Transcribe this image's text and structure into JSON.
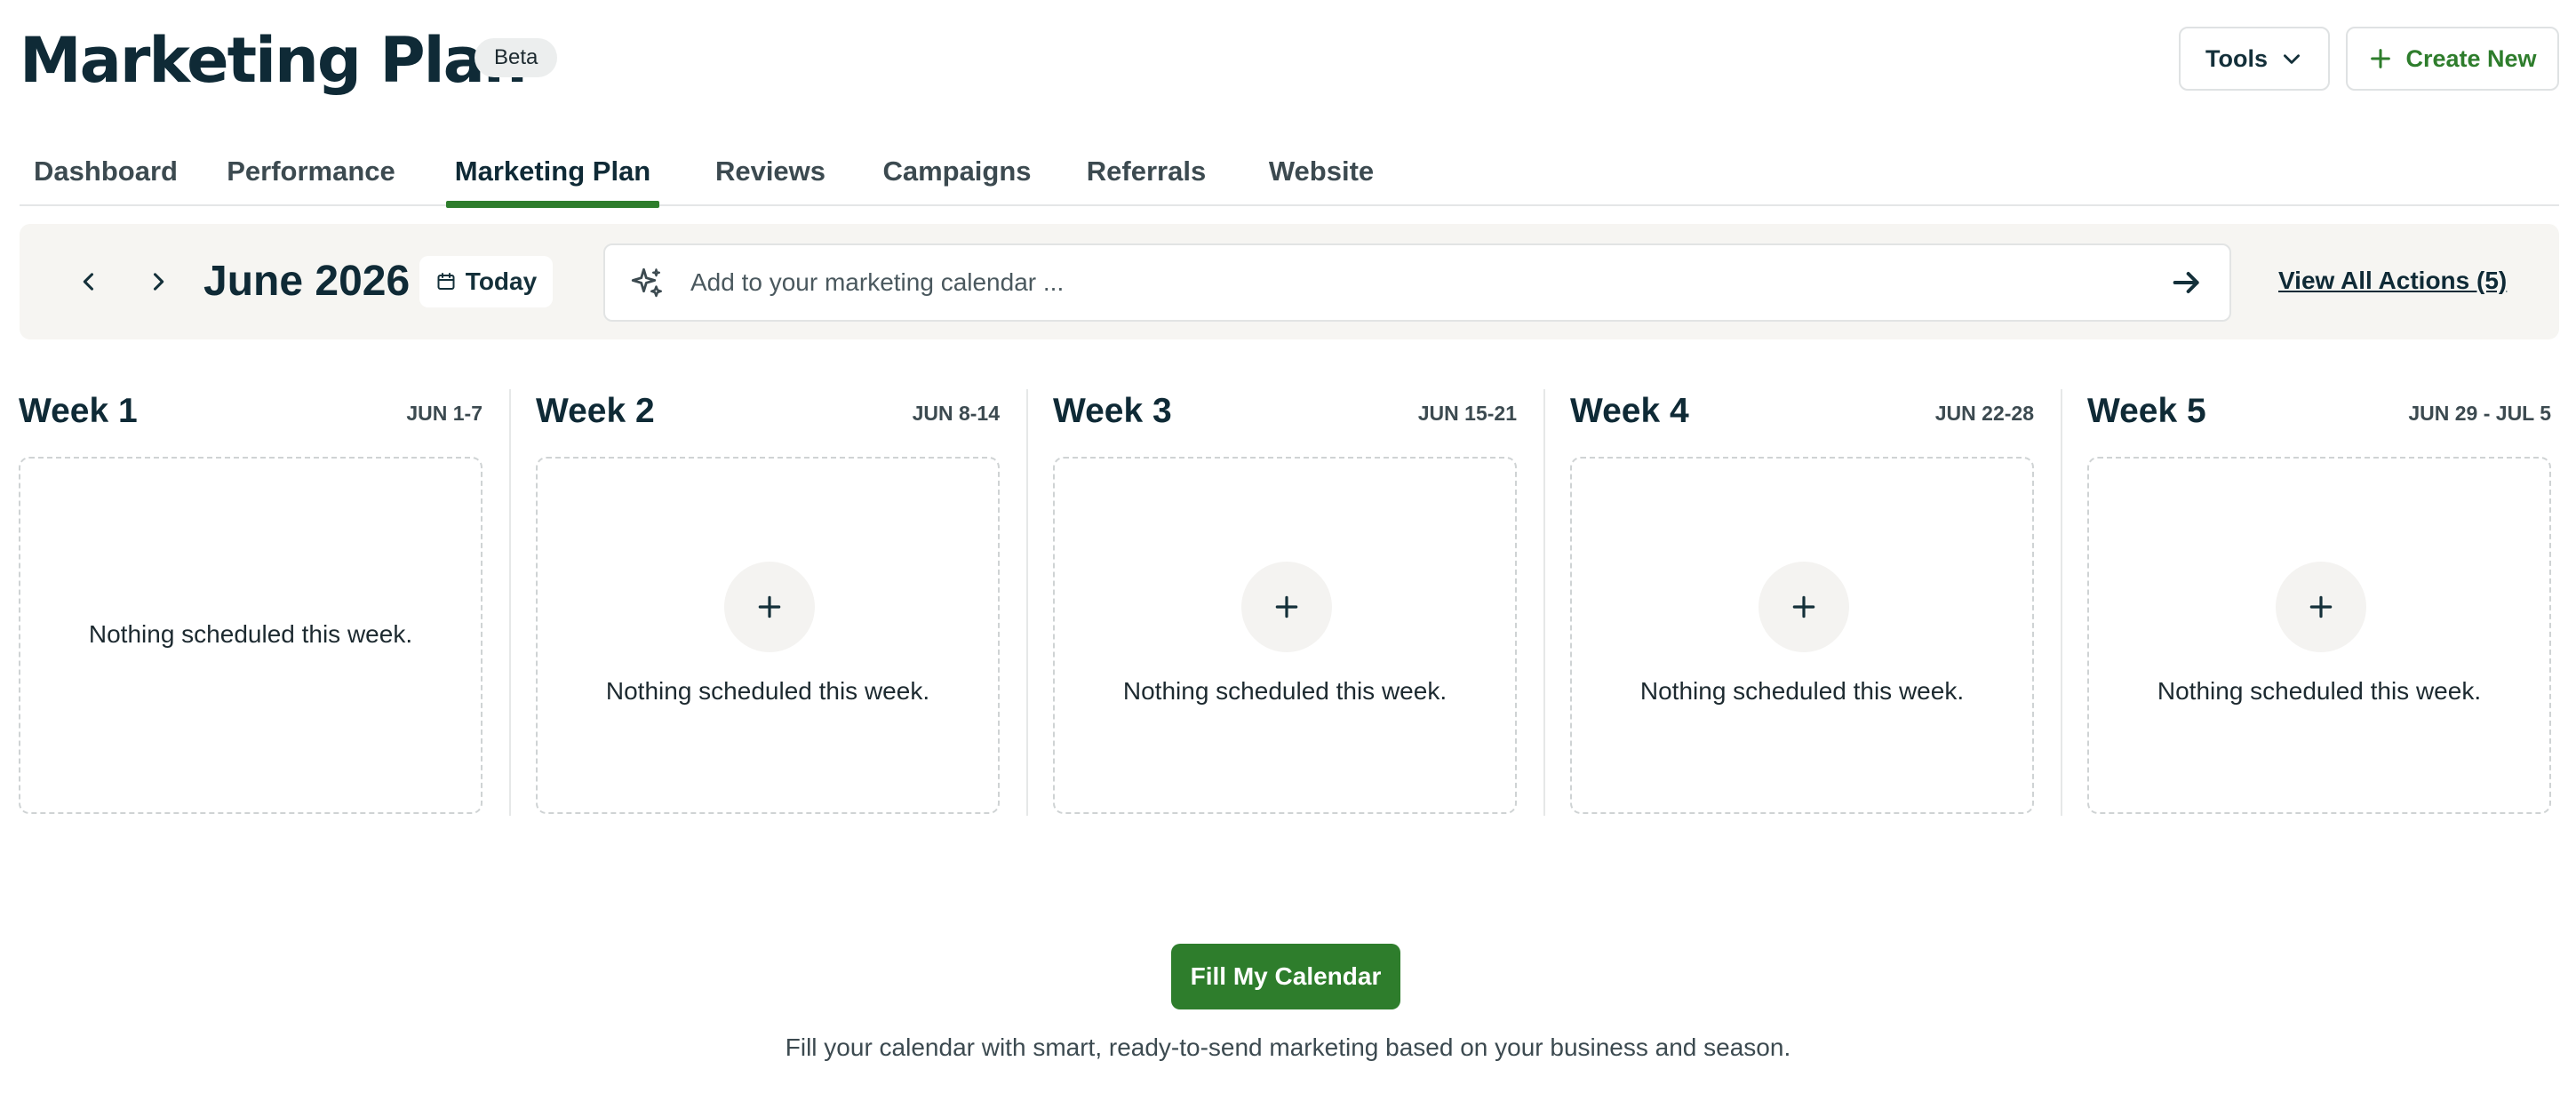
{
  "header": {
    "title": "Marketing Plan",
    "badge": "Beta",
    "tools_label": "Tools",
    "create_label": "Create New"
  },
  "tabs": [
    {
      "label": "Dashboard"
    },
    {
      "label": "Performance"
    },
    {
      "label": "Marketing Plan",
      "active": true
    },
    {
      "label": "Reviews"
    },
    {
      "label": "Campaigns"
    },
    {
      "label": "Referrals"
    },
    {
      "label": "Website"
    }
  ],
  "toolbar": {
    "month": "June 2026",
    "today_label": "Today",
    "input_placeholder": "Add to your marketing calendar ...",
    "view_all_label": "View All Actions (5)"
  },
  "weeks": [
    {
      "title": "Week 1",
      "range": "JUN 1-7",
      "empty_text": "Nothing scheduled this week."
    },
    {
      "title": "Week 2",
      "range": "JUN 8-14",
      "empty_text": "Nothing scheduled this week."
    },
    {
      "title": "Week 3",
      "range": "JUN 15-21",
      "empty_text": "Nothing scheduled this week."
    },
    {
      "title": "Week 4",
      "range": "JUN 22-28",
      "empty_text": "Nothing scheduled this week."
    },
    {
      "title": "Week 5",
      "range": "JUN 29 - JUL 5",
      "empty_text": "Nothing scheduled this week."
    }
  ],
  "cta": {
    "button_label": "Fill My Calendar",
    "description": "Fill your calendar with smart, ready-to-send marketing based on your business and season."
  },
  "colors": {
    "accent": "#2e7d2c",
    "text_dark": "#0f2a36",
    "toolbar_bg": "#f6f5f2"
  }
}
